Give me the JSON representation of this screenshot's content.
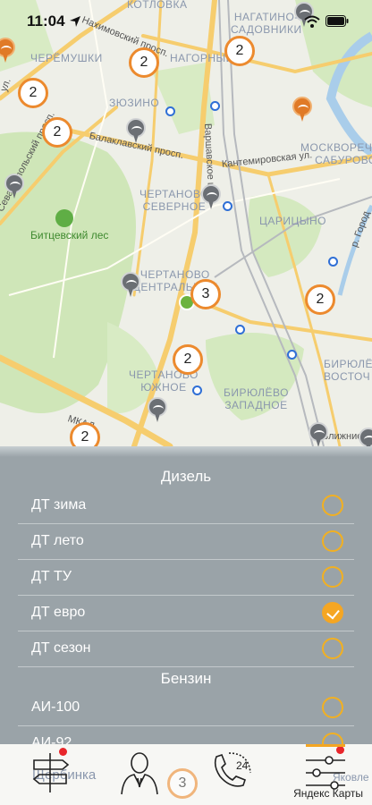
{
  "status_bar": {
    "time": "11:04"
  },
  "map": {
    "districts": [
      "КОТЛОВКА",
      "НАГАТИНО-\nСАДОВНИКИ",
      "ЧЕРЁМУШКИ",
      "НАГОРНЫЙ",
      "ЗЮЗИНО",
      "МОСКВОРЕЧЬЕ-\nСАБУРОВО",
      "ЧЕРТАНОВО\nСЕВЕРНОЕ",
      "ЦАРИЦЫНО",
      "ЧЕРТАНОВО\nЦЕНТРАЛЬНОЕ",
      "ЧЕРТАНОВО\nЮЖНОЕ",
      "БИРЮЛЁВО\nЗАПАДНОЕ",
      "БИРЮЛЁ\nВОСТОЧ"
    ],
    "streets": [
      "Нахимовский просп.",
      "Балаклавский просп.",
      "Кантемировская ул.",
      "Варшавское ш.",
      "Севастопольский просп.",
      "МКАД",
      "Ближние",
      "р. Город",
      "ул."
    ],
    "park_label": "Битцевский лес",
    "clusters": [
      "2",
      "2",
      "2",
      "2",
      "2",
      "2",
      "3",
      "2",
      "2",
      "2"
    ],
    "bottom_labels": {
      "left": "Щербинка",
      "right": "Яковле",
      "cluster": "3"
    }
  },
  "panel": {
    "sections": [
      {
        "title": "Дизель",
        "items": [
          {
            "label": "ДТ зима",
            "selected": false
          },
          {
            "label": "ДТ лето",
            "selected": false
          },
          {
            "label": "ДТ ТУ",
            "selected": false
          },
          {
            "label": "ДТ евро",
            "selected": true
          },
          {
            "label": "ДТ сезон",
            "selected": false
          }
        ]
      },
      {
        "title": "Бензин",
        "items": [
          {
            "label": "АИ-100",
            "selected": false
          },
          {
            "label": "АИ-92",
            "selected": false
          }
        ]
      }
    ]
  },
  "tabbar": {
    "tabs": [
      {
        "icon": "signpost-icon",
        "badge": true
      },
      {
        "icon": "person-icon",
        "badge": false
      },
      {
        "icon": "phone-24-icon",
        "badge": false,
        "text": "24"
      },
      {
        "icon": "filter-sliders-icon",
        "badge": true,
        "active": true
      }
    ],
    "attribution": "Яндекс Карты"
  },
  "colors": {
    "accent": "#f5a623",
    "cluster_ring": "#ec8a2e",
    "panel_bg": "#9aa3a8",
    "badge": "#e8262b",
    "metro": "#2f6fd6"
  }
}
